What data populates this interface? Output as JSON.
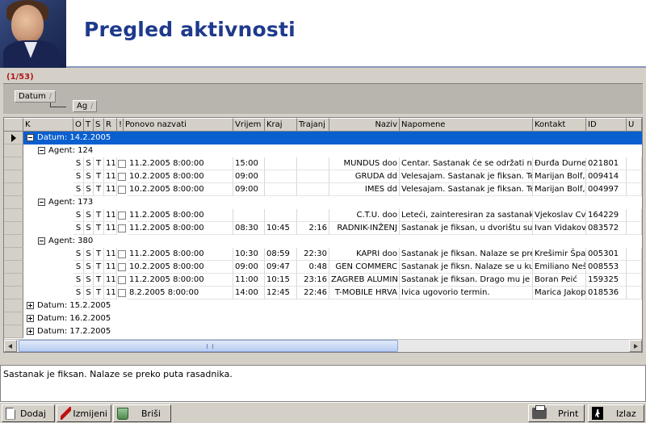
{
  "header": {
    "title": "Pregled aktivnosti"
  },
  "main": {
    "counter": "(1/53)",
    "group_chips": [
      {
        "label": "Datum",
        "sort": "/"
      },
      {
        "label": "Ag",
        "sort": "/"
      }
    ]
  },
  "grid": {
    "columns": [
      "K",
      "O",
      "T",
      "S",
      "R",
      "!",
      "Ponovo nazvati",
      "Vrijem",
      "Kraj",
      "Trajanj",
      "Naziv",
      "Napomene",
      "Kontakt",
      "ID",
      "U"
    ],
    "group_date_1": "Datum: 14.2.2005",
    "agent_124": "Agent: 124",
    "agent_173": "Agent: 173",
    "agent_380": "Agent: 380",
    "group_date_2": "Datum: 15.2.2005",
    "group_date_3": "Datum: 16.2.2005",
    "group_date_4": "Datum: 17.2.2005",
    "rows": [
      {
        "o": "S",
        "t": "S",
        "s": "T",
        "r": "11",
        "ponovo": "11.2.2005 8:00:00",
        "vrijem": "15:00",
        "kraj": "",
        "trajanj": "",
        "naziv": "MUNDUS doo",
        "napomene": "Centar. Sastanak će se održati na",
        "kontakt": "Đurđa Durne",
        "id": "021801"
      },
      {
        "o": "S",
        "t": "S",
        "s": "T",
        "r": "11",
        "ponovo": "10.2.2005 8:00:00",
        "vrijem": "09:00",
        "kraj": "",
        "trajanj": "",
        "naziv": "GRUDA dd",
        "napomene": "Velesajam. Sastanak je fiksan. Tel.",
        "kontakt": "Marijan Bolf,",
        "id": "009414"
      },
      {
        "o": "S",
        "t": "S",
        "s": "T",
        "r": "11",
        "ponovo": "10.2.2005 8:00:00",
        "vrijem": "09:00",
        "kraj": "",
        "trajanj": "",
        "naziv": "IMES dd",
        "napomene": "Velesajam. Sastanak je fiksan. Tel.",
        "kontakt": "Marijan Bolf,",
        "id": "004997"
      },
      {
        "o": "S",
        "t": "S",
        "s": "T",
        "r": "11",
        "ponovo": "11.2.2005 8:00:00",
        "vrijem": "",
        "kraj": "",
        "trajanj": "",
        "naziv": "C.T.U. doo",
        "napomene": "Leteći, zainteresiran za sastanak, a",
        "kontakt": "Vjekoslav Cv",
        "id": "164229"
      },
      {
        "o": "S",
        "t": "S",
        "s": "T",
        "r": "11",
        "ponovo": "11.2.2005 8:00:00",
        "vrijem": "08:30",
        "kraj": "10:45",
        "trajanj": "2:16",
        "naziv": "RADNIK-INŽENJ",
        "napomene": "Sastanak je fiksan, u dvorištu su",
        "kontakt": "Ivan Vidakovi",
        "id": "083572"
      },
      {
        "o": "S",
        "t": "S",
        "s": "T",
        "r": "11",
        "ponovo": "11.2.2005 8:00:00",
        "vrijem": "10:30",
        "kraj": "08:59",
        "trajanj": "22:30",
        "naziv": "KAPRI doo",
        "napomene": "Sastanak je fiksan. Nalaze se prek",
        "kontakt": "Krešimir Špar",
        "id": "005301"
      },
      {
        "o": "S",
        "t": "S",
        "s": "T",
        "r": "11",
        "ponovo": "10.2.2005 8:00:00",
        "vrijem": "09:00",
        "kraj": "09:47",
        "trajanj": "0:48",
        "naziv": "GEN COMMERC",
        "napomene": "Sastanak je fiksn. Nalaze se u ku",
        "kontakt": "Emiliano Neš",
        "id": "008553"
      },
      {
        "o": "S",
        "t": "S",
        "s": "T",
        "r": "11",
        "ponovo": "11.2.2005 8:00:00",
        "vrijem": "11:00",
        "kraj": "10:15",
        "trajanj": "23:16",
        "naziv": "ZAGREB ALUMIN",
        "napomene": "Sastanak je fiksan. Drago mu je da",
        "kontakt": "Boran Peić",
        "id": "159325"
      },
      {
        "o": "S",
        "t": "S",
        "s": "T",
        "r": "11",
        "ponovo": "8.2.2005 8:00:00",
        "vrijem": "14:00",
        "kraj": "12:45",
        "trajanj": "22:46",
        "naziv": "T-MOBILE HRVA",
        "napomene": "Ivica ugovorio termin.",
        "kontakt": "Marica Jakop",
        "id": "018536"
      }
    ]
  },
  "note": {
    "text": "Sastanak je fiksan. Nalaze se preko puta rasadnika."
  },
  "toolbar": {
    "add": "Dodaj",
    "edit": "Izmijeni",
    "delete": "Briši",
    "print": "Print",
    "exit": "Izlaz"
  }
}
